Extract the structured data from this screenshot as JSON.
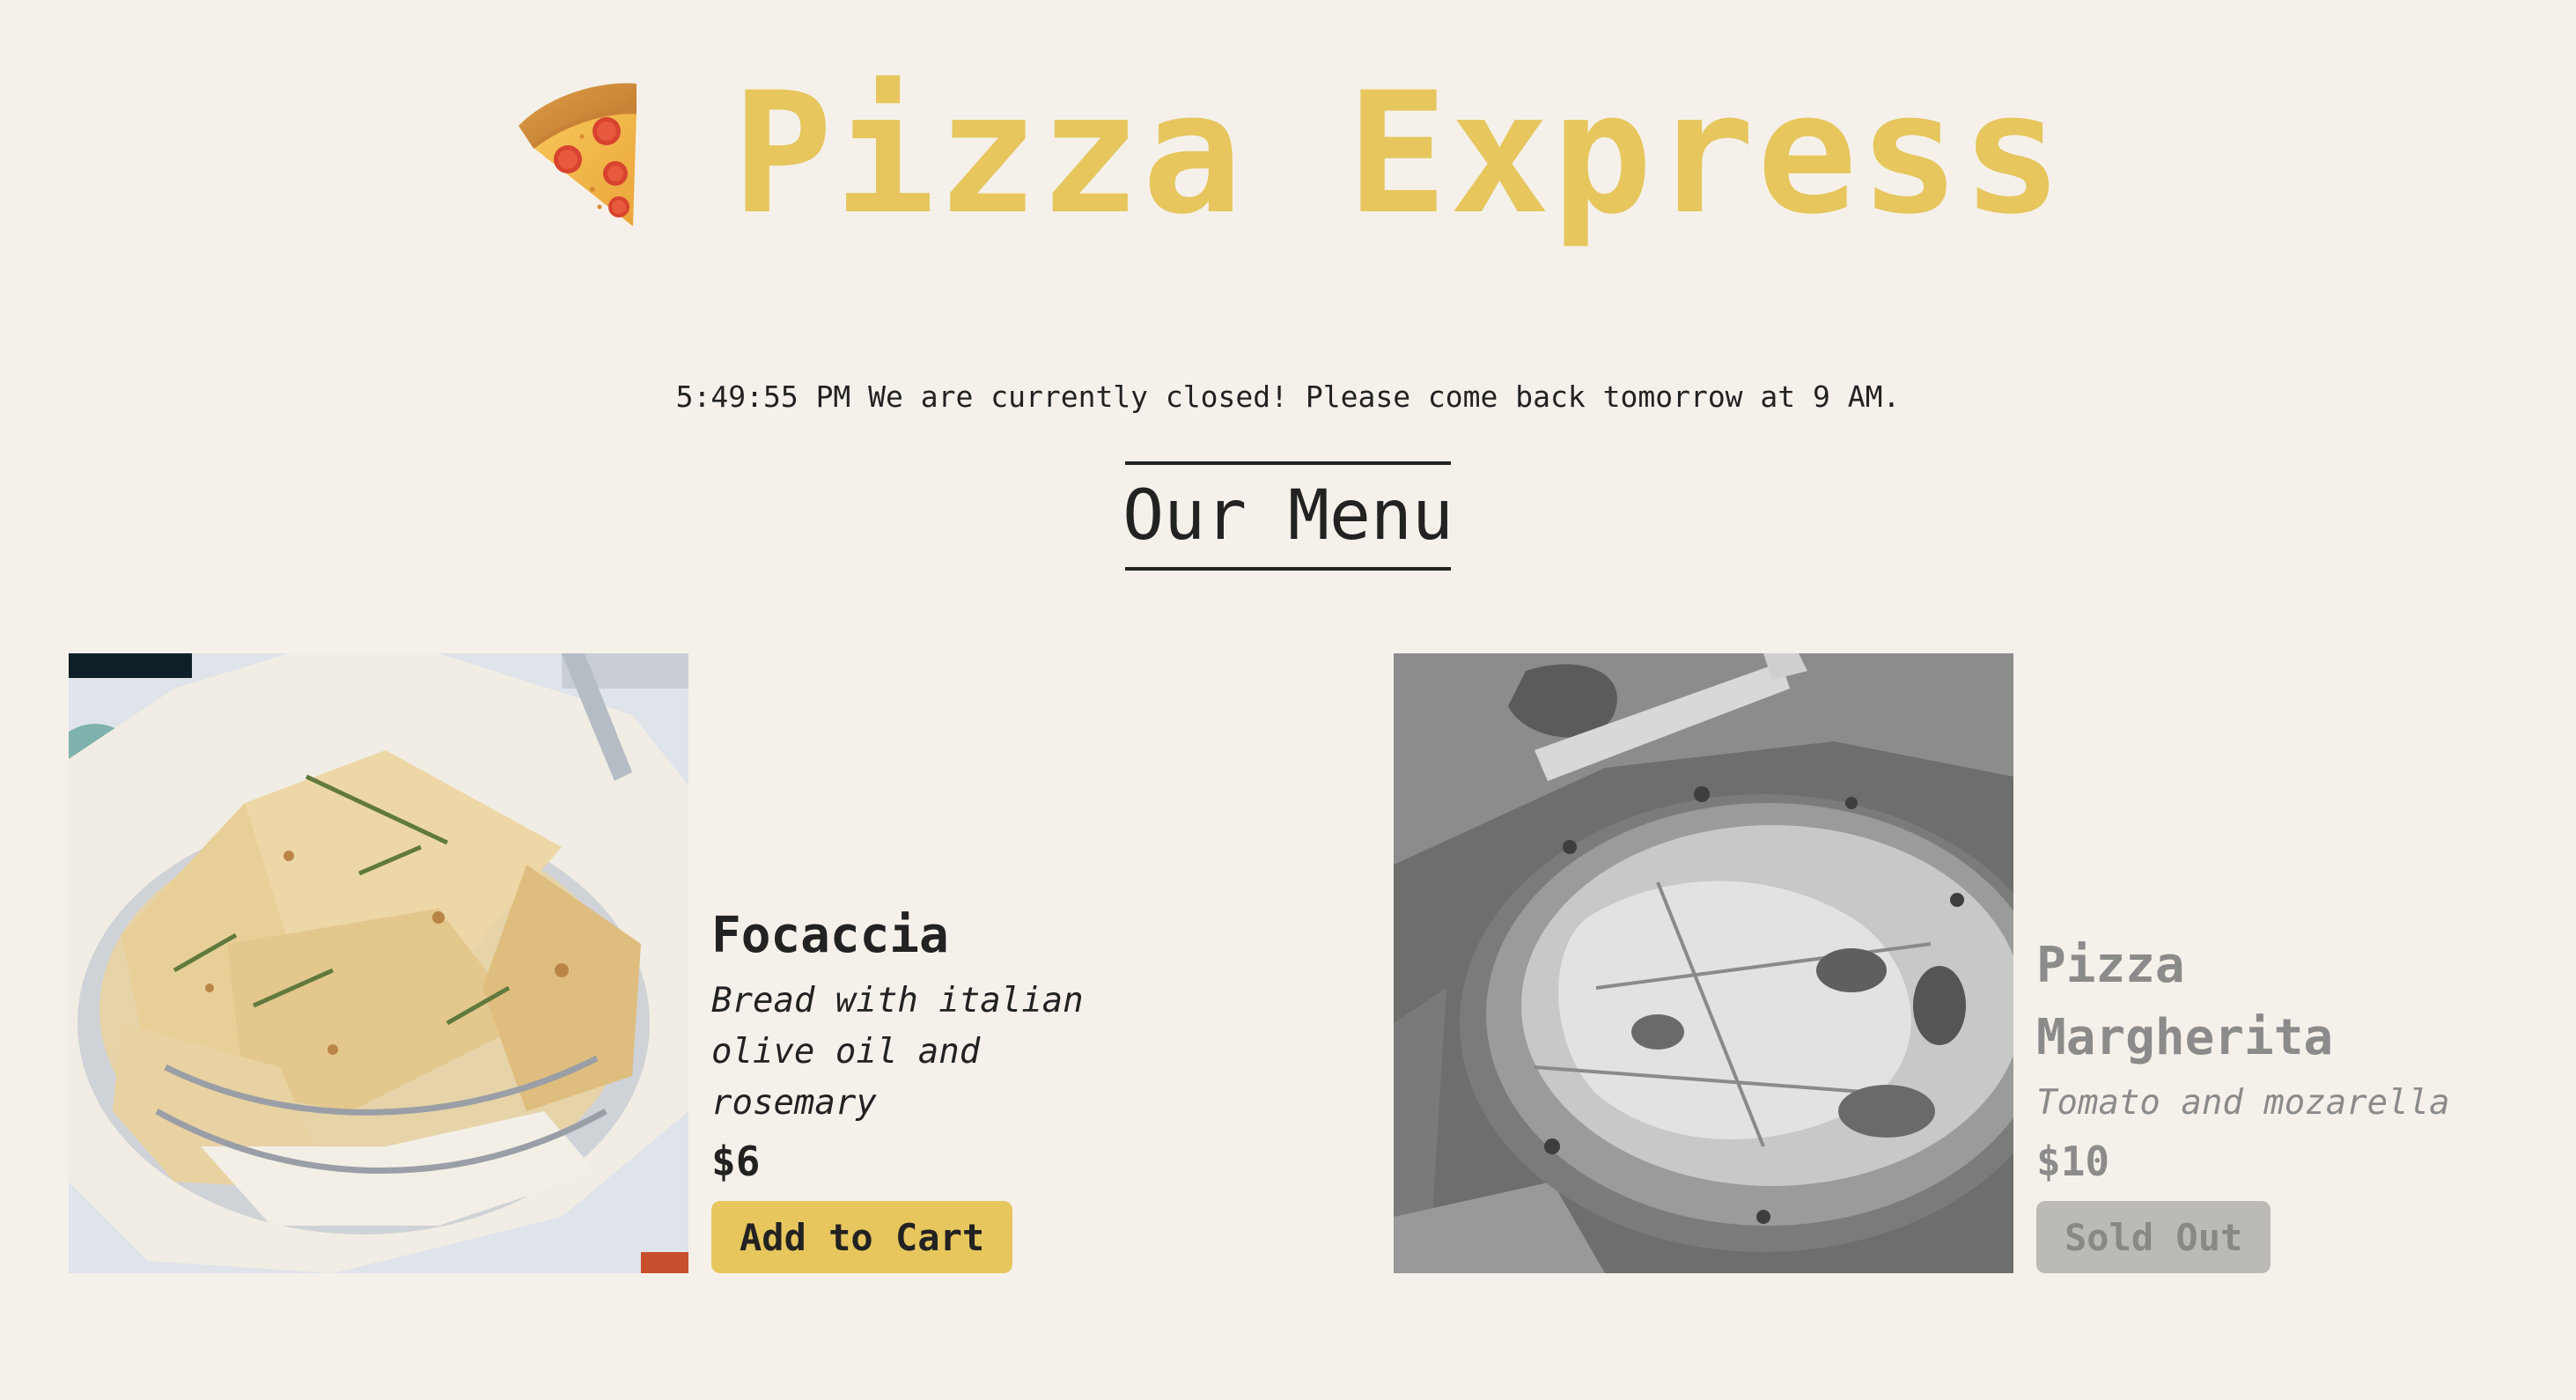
{
  "header": {
    "title": "Pizza Express",
    "icon": "pizza-slice-icon",
    "title_color": "#e6c65d"
  },
  "status": {
    "message": "5:49:55 PM We are currently closed! Please come back tomorrow at 9 AM."
  },
  "menu": {
    "heading": "Our Menu",
    "items": [
      {
        "name": "Focaccia",
        "description": "Bread with italian olive oil and rosemary",
        "price": "$6",
        "button_label": "Add to Cart",
        "image": "focaccia-photo",
        "sold_out": false
      },
      {
        "name": "Pizza Margherita",
        "description": "Tomato and mozarella",
        "price": "$10",
        "button_label": "Sold Out",
        "image": "pizza-margherita-photo",
        "sold_out": true
      }
    ]
  },
  "colors": {
    "background": "#f5f1ea",
    "accent": "#e6c65d",
    "text": "#222222",
    "muted": "#8b8b8b"
  }
}
